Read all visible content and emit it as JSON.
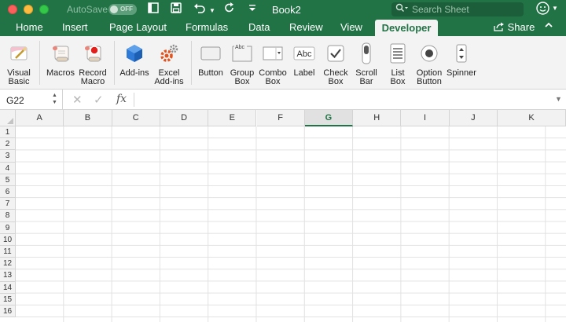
{
  "titlebar": {
    "autosave_label": "AutoSave",
    "autosave_state": "OFF",
    "document_title": "Book2",
    "search_placeholder": "Search Sheet",
    "icons": [
      "sidebar-icon",
      "save-icon",
      "undo-icon",
      "redo-icon",
      "customize-icon",
      "smiley-icon"
    ]
  },
  "tabs": [
    {
      "label": "Home"
    },
    {
      "label": "Insert"
    },
    {
      "label": "Page Layout"
    },
    {
      "label": "Formulas"
    },
    {
      "label": "Data"
    },
    {
      "label": "Review"
    },
    {
      "label": "View"
    },
    {
      "label": "Developer",
      "active": true
    }
  ],
  "share_label": "Share",
  "ribbon": [
    {
      "label": "Visual\nBasic",
      "icon": "visual-basic-icon"
    },
    {
      "label": "Macros",
      "icon": "macros-icon"
    },
    {
      "label": "Record\nMacro",
      "icon": "record-macro-icon"
    },
    {
      "label": "Add-ins",
      "icon": "add-ins-icon"
    },
    {
      "label": "Excel\nAdd-ins",
      "icon": "excel-add-ins-icon"
    },
    {
      "label": "Button",
      "icon": "button-control-icon"
    },
    {
      "label": "Group\nBox",
      "icon": "group-box-icon"
    },
    {
      "label": "Combo\nBox",
      "icon": "combo-box-icon"
    },
    {
      "label": "Label",
      "icon": "label-control-icon"
    },
    {
      "label": "Check\nBox",
      "icon": "check-box-icon"
    },
    {
      "label": "Scroll\nBar",
      "icon": "scroll-bar-icon"
    },
    {
      "label": "List\nBox",
      "icon": "list-box-icon"
    },
    {
      "label": "Option\nButton",
      "icon": "option-button-icon"
    },
    {
      "label": "Spinner",
      "icon": "spinner-icon"
    }
  ],
  "icon_text": {
    "group_box": "Abc",
    "label": "Abc"
  },
  "formula_bar": {
    "name_box": "G22",
    "fx": "fx",
    "value": ""
  },
  "columns": [
    "A",
    "B",
    "C",
    "D",
    "E",
    "F",
    "G",
    "H",
    "I",
    "J",
    "K"
  ],
  "selected_column": "G",
  "rows": [
    "1",
    "2",
    "3",
    "4",
    "5",
    "6",
    "7",
    "8",
    "9",
    "10",
    "11",
    "12",
    "13",
    "14",
    "15",
    "16"
  ],
  "colors": {
    "accent": "#217346",
    "ribbon_bg": "#f3f3f3",
    "grid_line": "#e2e2e2"
  }
}
